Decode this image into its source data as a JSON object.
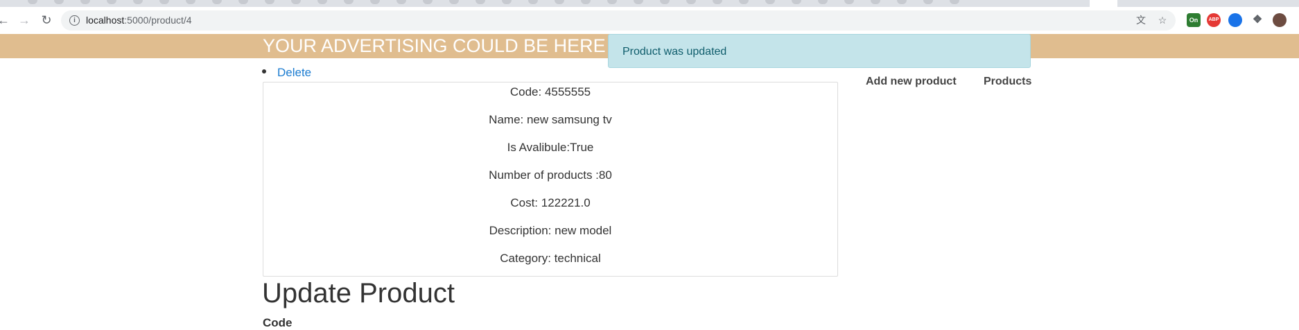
{
  "browser": {
    "url_host": "localhost",
    "url_path": ":5000/product/4",
    "extensions": [
      {
        "name": "on-extension-icon",
        "label": "On",
        "color": "#2e7d32"
      },
      {
        "name": "abp-icon",
        "label": "ABP",
        "color": "#e53935"
      },
      {
        "name": "blue-extension-icon",
        "label": "",
        "color": "#1a73e8"
      },
      {
        "name": "puzzle-extensions-icon",
        "label": "",
        "color": "#5f6368"
      },
      {
        "name": "profile-avatar-icon",
        "label": "",
        "color": "#6d4c41"
      }
    ]
  },
  "ad_banner": {
    "text": "YOUR ADVERTISING COULD BE HERE"
  },
  "flash_message": "Product was updated",
  "actions": {
    "delete_label": "Delete"
  },
  "sidebar": {
    "add_new_product": "Add new product",
    "products": "Products"
  },
  "product": {
    "fields": [
      "Code: 4555555",
      "Name: new samsung tv",
      "Is Avalibule:True",
      "Number of products :80",
      "Cost: 122221.0",
      "Description: new model",
      "Category: technical"
    ]
  },
  "form": {
    "title": "Update Product",
    "code_label": "Code"
  }
}
